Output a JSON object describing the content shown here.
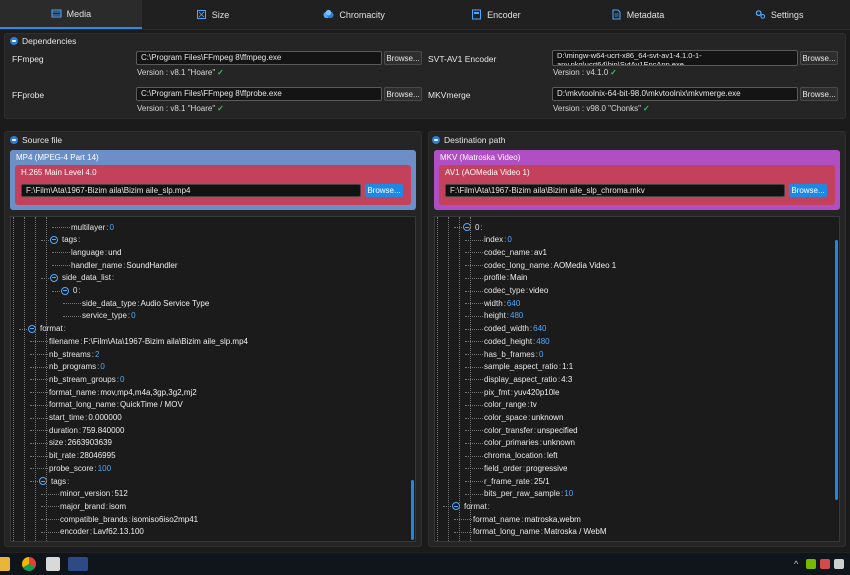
{
  "tabs": [
    {
      "label": "Media",
      "icon": "film-icon",
      "active": true
    },
    {
      "label": "Size",
      "icon": "resize-icon",
      "active": false
    },
    {
      "label": "Chromacity",
      "icon": "palette-icon",
      "active": false
    },
    {
      "label": "Encoder",
      "icon": "encoder-icon",
      "active": false
    },
    {
      "label": "Metadata",
      "icon": "document-icon",
      "active": false
    },
    {
      "label": "Settings",
      "icon": "gears-icon",
      "active": false
    }
  ],
  "dependencies": {
    "title": "Dependencies",
    "browse_label": "Browse...",
    "items": [
      {
        "name": "FFmpeg",
        "path": "C:\\Program Files\\FFmpeg 8\\ffmpeg.exe",
        "version": "Version : v8.1 \"Hoare\""
      },
      {
        "name": "SVT-AV1 Encoder",
        "path": "D:\\mingw-w64-ucrt-x86_64-svt-av1-4.1.0-1-any.pkg\\ucrt64\\bin\\SvtAv1EncApp.exe",
        "version": "Version : v4.1.0"
      },
      {
        "name": "FFprobe",
        "path": "C:\\Program Files\\FFmpeg 8\\ffprobe.exe",
        "version": "Version : v8.1 \"Hoare\""
      },
      {
        "name": "MKVmerge",
        "path": "D:\\mkvtoolnix-64-bit-98.0\\mkvtoolnix\\mkvmerge.exe",
        "version": "Version : v98.0 \"Chonks\""
      }
    ],
    "check_mark": "✓"
  },
  "source": {
    "title": "Source file",
    "container": "MP4 (MPEG-4 Part 14)",
    "codec": "H.265 Main Level 4.0",
    "path": "F:\\Film\\Ata\\1967-Bizim aila\\Bizim aile_slp.mp4",
    "browse_label": "Browse...",
    "colors": {
      "container": "#6c8fc7",
      "codec": "#c3415a"
    },
    "tree": [
      {
        "k": "multilayer",
        "v": "0",
        "num": true
      },
      {
        "k": "tags",
        "v": "",
        "toggle": true
      },
      {
        "k": "language",
        "v": "und",
        "num": false
      },
      {
        "k": "handler_name",
        "v": "SoundHandler",
        "num": false
      },
      {
        "k": "side_data_list",
        "v": "",
        "toggle": true
      },
      {
        "k": "0",
        "v": "",
        "toggle": true
      },
      {
        "k": "side_data_type",
        "v": "Audio Service Type",
        "num": false
      },
      {
        "k": "service_type",
        "v": "0",
        "num": true
      },
      {
        "k": "format",
        "v": "",
        "toggle": true
      },
      {
        "k": "filename",
        "v": "F:\\Film\\Ata\\1967-Bizim aila\\Bizim aile_slp.mp4",
        "num": false
      },
      {
        "k": "nb_streams",
        "v": "2",
        "num": true
      },
      {
        "k": "nb_programs",
        "v": "0",
        "num": true
      },
      {
        "k": "nb_stream_groups",
        "v": "0",
        "num": true
      },
      {
        "k": "format_name",
        "v": "mov,mp4,m4a,3gp,3g2,mj2",
        "num": false
      },
      {
        "k": "format_long_name",
        "v": "QuickTime / MOV",
        "num": false
      },
      {
        "k": "start_time",
        "v": "0.000000",
        "num": false
      },
      {
        "k": "duration",
        "v": "759.840000",
        "num": false
      },
      {
        "k": "size",
        "v": "2663903639",
        "num": false
      },
      {
        "k": "bit_rate",
        "v": "28046995",
        "num": false
      },
      {
        "k": "probe_score",
        "v": "100",
        "num": true
      },
      {
        "k": "tags",
        "v": "",
        "toggle": true
      },
      {
        "k": "minor_version",
        "v": "512",
        "num": false
      },
      {
        "k": "major_brand",
        "v": "isom",
        "num": false
      },
      {
        "k": "compatible_brands",
        "v": "isomiso6iso2mp41",
        "num": false
      },
      {
        "k": "encoder",
        "v": "Lavf62.13.100",
        "num": false
      }
    ]
  },
  "destination": {
    "title": "Destination path",
    "container": "MKV (Matroska Video)",
    "codec": "AV1 (AOMedia Video 1)",
    "path": "F:\\Film\\Ata\\1967-Bizim aila\\Bizim aile_slp_chroma.mkv",
    "browse_label": "Browse...",
    "colors": {
      "container": "#b04fc4",
      "codec": "#c3415a"
    },
    "tree": [
      {
        "k": "0",
        "v": "",
        "toggle": true
      },
      {
        "k": "index",
        "v": "0",
        "num": true
      },
      {
        "k": "codec_name",
        "v": "av1",
        "num": false
      },
      {
        "k": "codec_long_name",
        "v": "AOMedia Video 1",
        "num": false
      },
      {
        "k": "profile",
        "v": "Main",
        "num": false
      },
      {
        "k": "codec_type",
        "v": "video",
        "num": false
      },
      {
        "k": "width",
        "v": "640",
        "num": true
      },
      {
        "k": "height",
        "v": "480",
        "num": true
      },
      {
        "k": "coded_width",
        "v": "640",
        "num": true
      },
      {
        "k": "coded_height",
        "v": "480",
        "num": true
      },
      {
        "k": "has_b_frames",
        "v": "0",
        "num": true
      },
      {
        "k": "sample_aspect_ratio",
        "v": "1:1",
        "num": false
      },
      {
        "k": "display_aspect_ratio",
        "v": "4:3",
        "num": false
      },
      {
        "k": "pix_fmt",
        "v": "yuv420p10le",
        "num": false
      },
      {
        "k": "color_range",
        "v": "tv",
        "num": false
      },
      {
        "k": "color_space",
        "v": "unknown",
        "num": false
      },
      {
        "k": "color_transfer",
        "v": "unspecified",
        "num": false
      },
      {
        "k": "color_primaries",
        "v": "unknown",
        "num": false
      },
      {
        "k": "chroma_location",
        "v": "left",
        "num": false
      },
      {
        "k": "field_order",
        "v": "progressive",
        "num": false
      },
      {
        "k": "r_frame_rate",
        "v": "25/1",
        "num": false
      },
      {
        "k": "bits_per_raw_sample",
        "v": "10",
        "num": true
      },
      {
        "k": "format",
        "v": "",
        "toggle": true
      },
      {
        "k": "format_name",
        "v": "matroska,webm",
        "num": false
      },
      {
        "k": "format_long_name",
        "v": "Matroska / WebM",
        "num": false
      }
    ]
  }
}
